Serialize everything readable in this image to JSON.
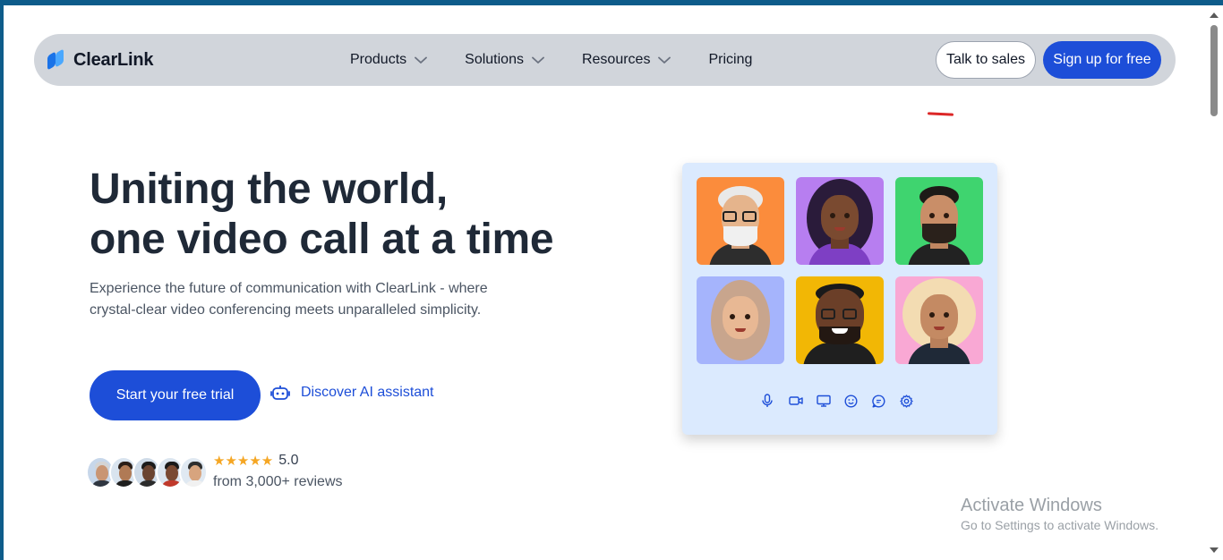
{
  "brand": {
    "name": "ClearLink"
  },
  "nav": {
    "menu": [
      {
        "label": "Products",
        "has_dropdown": true
      },
      {
        "label": "Solutions",
        "has_dropdown": true
      },
      {
        "label": "Resources",
        "has_dropdown": true
      },
      {
        "label": "Pricing",
        "has_dropdown": false
      }
    ],
    "talk_to_sales": "Talk to sales",
    "sign_up": "Sign up for free"
  },
  "hero": {
    "title_line1": "Uniting the world,",
    "title_line2": "one video call at a time",
    "subtitle": "Experience the future of communication with ClearLink - where crystal-clear video conferencing meets unparalleled simplicity.",
    "primary_cta": "Start your free trial",
    "secondary_cta": "Discover AI assistant",
    "secondary_icon": "robot-icon"
  },
  "reviews": {
    "stars": "★★★★★",
    "rating": "5.0",
    "summary": "from 3,000+ reviews"
  },
  "video_card": {
    "participants": [
      {
        "bg": "#fb8c3c"
      },
      {
        "bg": "#b77ef0"
      },
      {
        "bg": "#3fd46f"
      },
      {
        "bg": "#a5b4fc"
      },
      {
        "bg": "#f2b705"
      },
      {
        "bg": "#f9a8d4"
      }
    ],
    "controls": [
      "microphone-icon",
      "video-camera-icon",
      "screen-share-icon",
      "emoji-icon",
      "chat-icon",
      "settings-icon"
    ]
  },
  "watermark": {
    "title": "Activate Windows",
    "subtitle": "Go to Settings to activate Windows."
  },
  "colors": {
    "primary": "#1d4ed8",
    "nav_bg": "#d1d5db",
    "card_bg": "#dbeafe",
    "star": "#f5a623"
  }
}
